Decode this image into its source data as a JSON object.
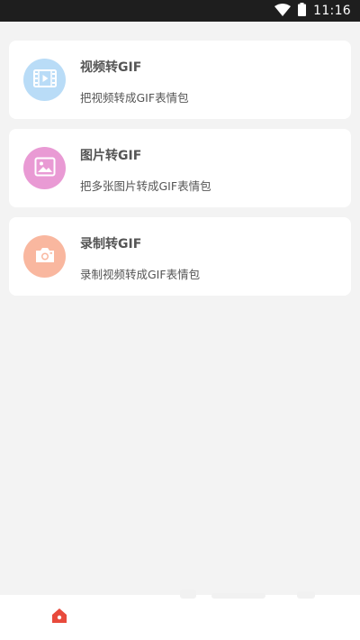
{
  "status_bar": {
    "time": "11:16",
    "icons": [
      "wifi-icon",
      "battery-icon"
    ]
  },
  "cards": [
    {
      "title": "视频转GIF",
      "description": "把视频转成GIF表情包",
      "icon": "video-icon",
      "color": "#b9dcf7"
    },
    {
      "title": "图片转GIF",
      "description": "把多张图片转成GIF表情包",
      "icon": "image-icon",
      "color": "#e99ad4"
    },
    {
      "title": "录制转GIF",
      "description": "录制视频转成GIF表情包",
      "icon": "camera-icon",
      "color": "#f9b79f"
    }
  ],
  "bottom_nav": {
    "items": [
      {
        "icon": "home-icon",
        "color": "#e84a3c",
        "selected": true
      }
    ]
  }
}
